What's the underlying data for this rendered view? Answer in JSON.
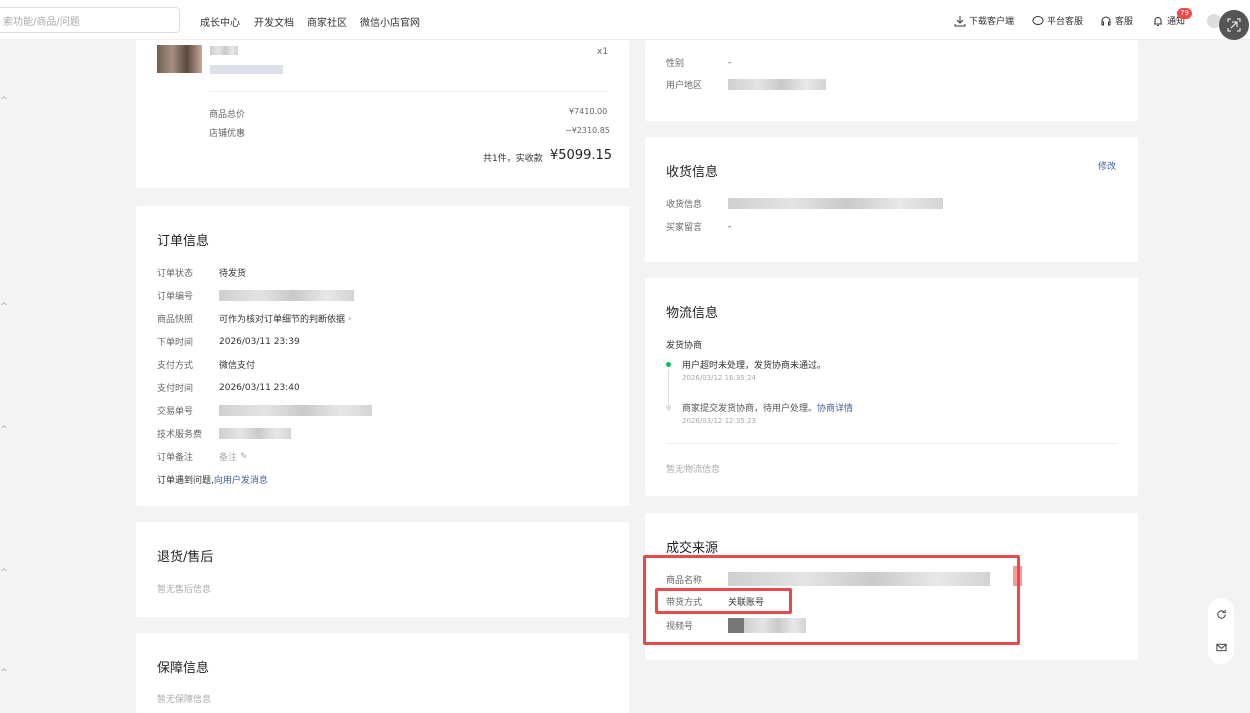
{
  "topbar": {
    "search_placeholder": "索功能/商品/问题",
    "nav": [
      "成长中心",
      "开发文档",
      "商家社区",
      "微信小店官网"
    ],
    "download_client": "下载客户端",
    "platform_service": "平台客服",
    "service": "客服",
    "notify": "通知",
    "notify_count": "79"
  },
  "product_summary": {
    "qty": "x1",
    "total_label": "商品总价",
    "total_value": "¥7410.00",
    "discount_label": "店铺优惠",
    "discount_value": "−¥2310.85",
    "paid_prefix": "共1件，实收款",
    "paid_value": "¥5099.15"
  },
  "order_info": {
    "title": "订单信息",
    "status_label": "订单状态",
    "status_value": "待发货",
    "order_no_label": "订单编号",
    "snapshot_label": "商品快照",
    "snapshot_value": "可作为核对订单细节的判断依据",
    "order_time_label": "下单时间",
    "order_time_value": "2026/03/11 23:39",
    "pay_method_label": "支付方式",
    "pay_method_value": "微信支付",
    "pay_time_label": "支付时间",
    "pay_time_value": "2026/03/11 23:40",
    "trade_no_label": "交易单号",
    "tech_fee_label": "技术服务费",
    "note_label": "订单备注",
    "note_value": "备注",
    "problem_text": "订单遇到问题,",
    "message_link": "向用户发消息"
  },
  "refund": {
    "title": "退货/售后",
    "empty": "暂无售后信息"
  },
  "guarantee": {
    "title": "保障信息",
    "empty": "暂无保障信息"
  },
  "buyer": {
    "gender_label": "性别",
    "gender_value": "-",
    "region_label": "用户地区"
  },
  "receive": {
    "title": "收货信息",
    "edit": "修改",
    "addr_label": "收货信息",
    "msg_label": "买家留言",
    "msg_value": "-"
  },
  "logistics": {
    "title": "物流信息",
    "sub": "发货协商",
    "events": [
      {
        "text": "用户超时未处理，发货协商未通过。",
        "time": "2026/03/12 16:35:24",
        "link": ""
      },
      {
        "text": "商家提交发货协商，待用户处理。",
        "time": "2026/03/12 12:35:23",
        "link": "协商详情"
      }
    ],
    "empty": "暂无物流信息"
  },
  "source": {
    "title": "成交来源",
    "product_label": "商品名称",
    "method_label": "带货方式",
    "method_value": "关联账号",
    "channel_label": "视频号"
  },
  "colors": {
    "accent": "#3f5f9f",
    "highlight": "#e64a4a",
    "badge": "#f04848",
    "timeline": "#07c160"
  }
}
